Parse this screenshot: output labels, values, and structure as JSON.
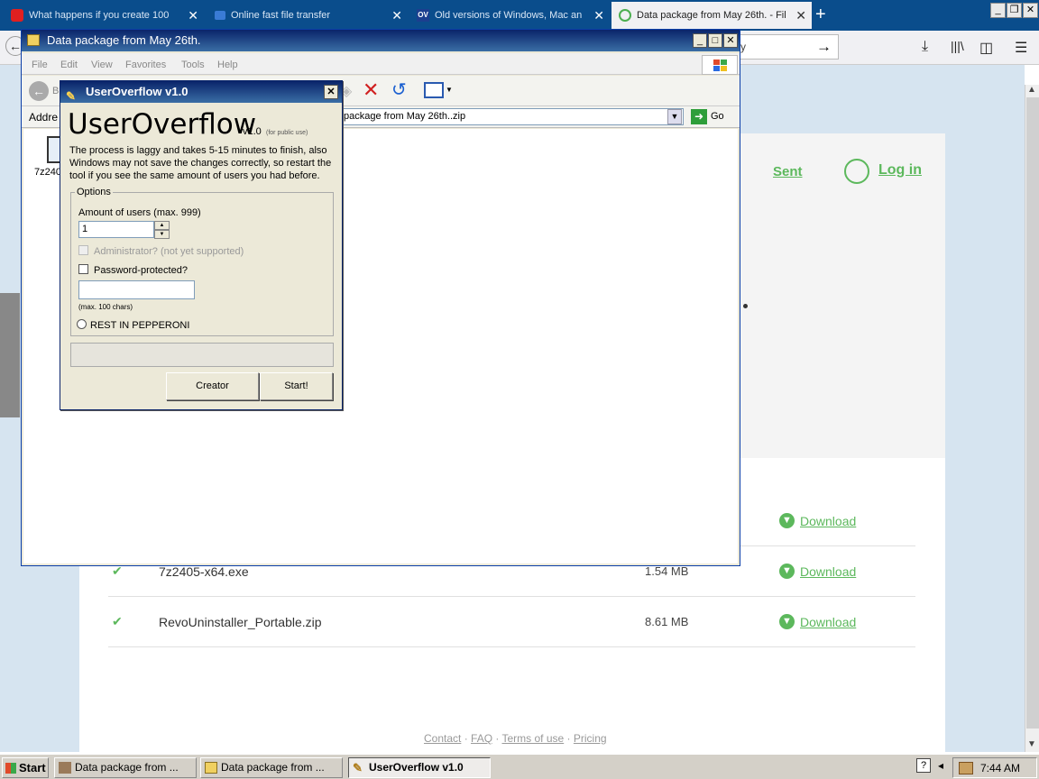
{
  "browser": {
    "tabs": [
      {
        "title": "What happens if you create 100",
        "icon": "youtube-icon"
      },
      {
        "title": "Online fast file transfer",
        "icon": "transfer-icon"
      },
      {
        "title": "Old versions of Windows, Mac an",
        "icon": "ov-icon"
      },
      {
        "title": "Data package from May 26th. - Fil",
        "icon": "loading-icon"
      }
    ],
    "new_tab": "+",
    "url_fragment": "y",
    "accent": "#0a4d8c"
  },
  "web": {
    "nav": {
      "sent": "Sent",
      "login": "Log in"
    },
    "brand_color": "#5cb85c",
    "files": [
      {
        "name": "7z2405-x64.exe",
        "size": "1.54 MB",
        "action": "Download"
      },
      {
        "name": "RevoUninstaller_Portable.zip",
        "size": "8.61 MB",
        "action": "Download"
      }
    ],
    "hidden_download": "Download",
    "footer": {
      "contact": "Contact",
      "faq": "FAQ",
      "terms": "Terms of use",
      "pricing": "Pricing",
      "sep": " · "
    }
  },
  "explorer": {
    "title": "Data package from May 26th.",
    "menu": [
      "File",
      "Edit",
      "View",
      "Favorites",
      "Tools",
      "Help"
    ],
    "back_label": "B",
    "address_label": "Addre",
    "address_value": "package from May 26th..zip",
    "go": "Go",
    "file_label": "7z240"
  },
  "dialog": {
    "title": "UserOverflow v1.0",
    "heading": "UserOverflow",
    "version": "v1.0",
    "public_use": "(for public use)",
    "description": "The process is laggy and takes 5-15 minutes to finish, also Windows may not save the changes correctly, so restart the tool if you see the same amount of users you had before.",
    "options_label": "Options",
    "amount_label": "Amount of users (max. 999)",
    "amount_value": "1",
    "admin_label": "Administrator? (not yet supported)",
    "password_label": "Password-protected?",
    "max_chars": "(max. 100 chars)",
    "radio_label": "REST IN PEPPERONI",
    "creator_button": "Creator",
    "start_button": "Start!"
  },
  "taskbar": {
    "start": "Start",
    "tasks": [
      {
        "label": "Data package from ...",
        "active": false
      },
      {
        "label": "Data package from ...",
        "active": false
      },
      {
        "label": "UserOverflow v1.0",
        "active": true
      }
    ],
    "clock": "7:44 AM"
  }
}
